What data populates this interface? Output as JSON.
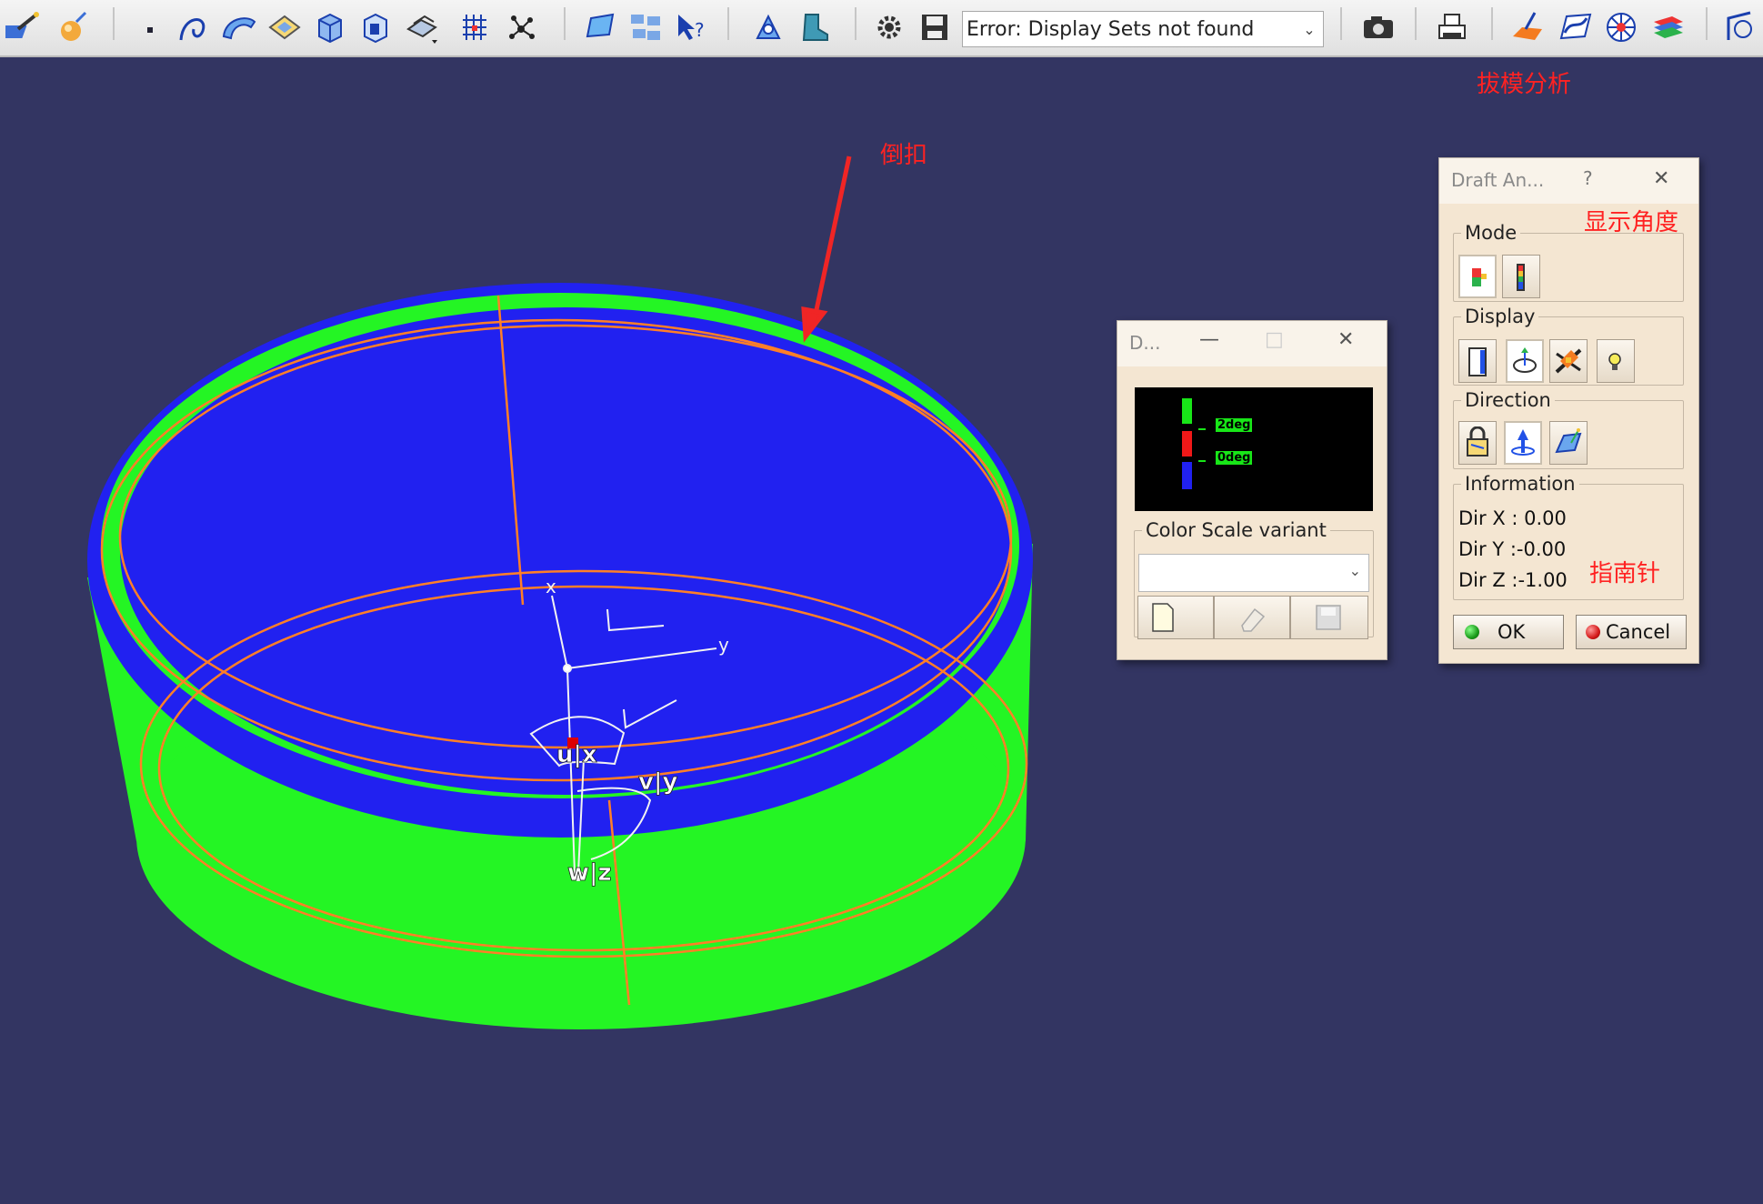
{
  "toolbar": {
    "display_sets_value": "Error: Display Sets not found",
    "icons": [
      "draft-analysis-icon",
      "sphere-icon",
      "point-icon",
      "curve-icon",
      "surface-icon",
      "plane-icon",
      "solid-icon",
      "body-icon",
      "assembly-icon",
      "grid-icon",
      "scatter-icon",
      "shape-icon",
      "multi-icon",
      "query-icon",
      "tools-icon",
      "boot-icon",
      "gear-icon",
      "save-icon",
      "camera-icon",
      "print-icon",
      "draft-analysis-icon",
      "curvature-icon",
      "mesh-icon",
      "stack-icon",
      "axis-icon"
    ]
  },
  "annotations": {
    "undercut": "倒扣",
    "draft_analysis": "拔模分析",
    "show_angle": "显示角度",
    "compass": "指南针"
  },
  "model": {
    "axis_labels": {
      "x": "x",
      "y": "y",
      "u": "u|x",
      "v": "v|y",
      "w": "w|z"
    },
    "colors": {
      "top_face": "#2121f0",
      "side_face": "#24f524",
      "edge_lines": "#ff7f27"
    }
  },
  "color_scale_dialog": {
    "title": "D...",
    "legend_top_label": "2deg",
    "legend_mid_label": "0deg",
    "legend_colors": [
      "#18e618",
      "#f01818",
      "#2121f0"
    ],
    "variant_label": "Color Scale variant",
    "variant_value": "",
    "buttons": [
      "new-icon",
      "eraser-icon",
      "save-icon"
    ]
  },
  "draft_dialog": {
    "title": "Draft An...",
    "help": "?",
    "close": "✕",
    "mode_label": "Mode",
    "display_label": "Display",
    "direction_label": "Direction",
    "information_label": "Information",
    "info": {
      "dir_x": "Dir X : 0.00",
      "dir_y": "Dir Y :-0.00",
      "dir_z": "Dir Z :-1.00"
    },
    "ok": "OK",
    "cancel": "Cancel"
  }
}
